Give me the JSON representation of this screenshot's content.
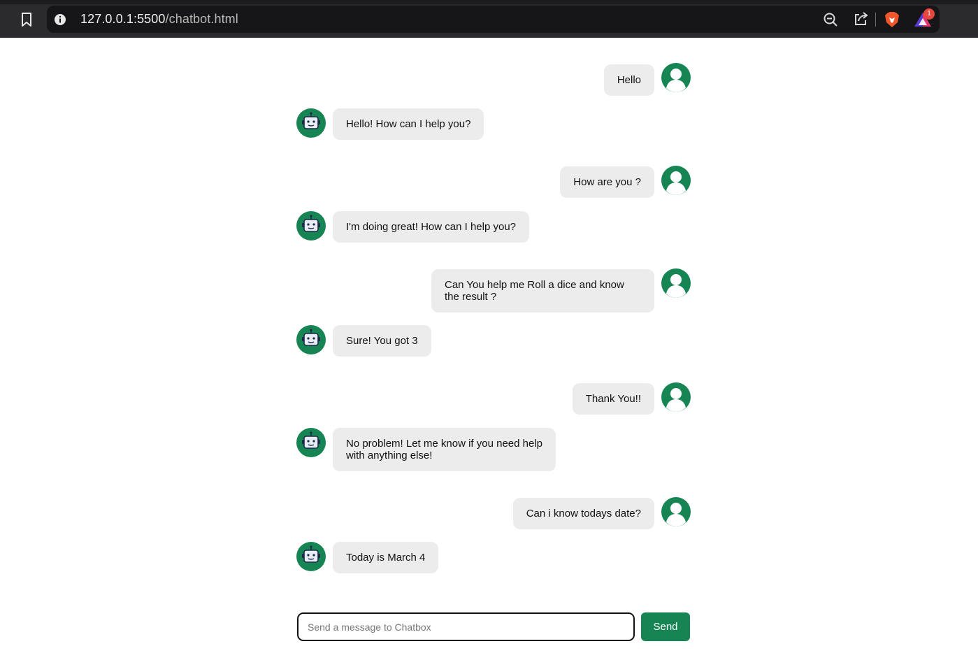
{
  "browser": {
    "url_host": "127.0.0.1:5500",
    "url_path": "/chatbot.html",
    "rewards_count": "1"
  },
  "messages": [
    {
      "sender": "user",
      "text": "Hello"
    },
    {
      "sender": "bot",
      "text": "Hello! How can I help you?"
    },
    {
      "sender": "user",
      "text": "How are you ?"
    },
    {
      "sender": "bot",
      "text": "I'm doing great! How can I help you?"
    },
    {
      "sender": "user",
      "text": "Can You help me Roll a dice and know the result ?"
    },
    {
      "sender": "bot",
      "text": "Sure! You got 3"
    },
    {
      "sender": "user",
      "text": "Thank You!!"
    },
    {
      "sender": "bot",
      "text": "No problem! Let me know if you need help with anything else!"
    },
    {
      "sender": "user",
      "text": "Can i know todays date?"
    },
    {
      "sender": "bot",
      "text": "Today is March 4"
    }
  ],
  "composer": {
    "placeholder": "Send a message to Chatbox",
    "send_label": "Send"
  },
  "colors": {
    "accent": "#168553",
    "bubble": "#ececec",
    "browser_bar": "#2b2b2e"
  }
}
